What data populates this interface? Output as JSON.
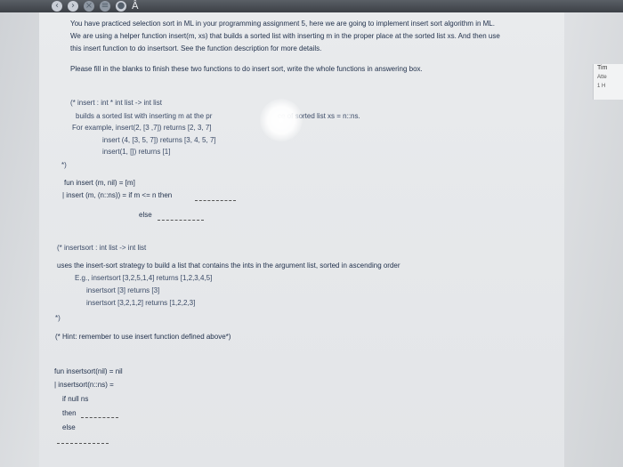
{
  "browser": {
    "icons": [
      "back-icon",
      "forward-icon",
      "close-tab-icon",
      "apps-icon",
      "profile-icon"
    ],
    "extra_glyph": "Â"
  },
  "side_panel": {
    "title": "Tim",
    "line2": "Atte",
    "line3": "1 H"
  },
  "assignment": {
    "intro_1": "You have practiced selection sort in ML in your programming assignment 5, here we are going to implement insert sort algorithm in ML.",
    "intro_2": "We are using a helper function insert(m, xs) that builds a sorted list with inserting m in the proper place at the sorted list xs. And then use",
    "intro_3": "this insert function to do insertsort. See the function description for more details.",
    "instruction": "Please fill in the blanks to finish these two functions to do insert sort, write the whole functions in answering box.",
    "insert_comment": [
      "(* insert : int * int list -> int list",
      "builds a sorted list with inserting m at the pr",
      "ce of sorted list xs = n::ns.",
      "For example,  insert(2, [3 ,7])  returns  [2, 3, 7]",
      "insert (4, [3, 5, 7])  returns  [3, 4, 5, 7]",
      "insert(1, [])  returns  [1]",
      "*)"
    ],
    "insert_code": [
      "fun insert (m, nil) = [m]",
      "| insert (m, (n::ns)) = if m <= n then",
      "else"
    ],
    "insertsort_comment": [
      "(* insertsort : int list -> int list",
      "uses the insert-sort strategy to build a list that contains the ints in the argument list, sorted in ascending order",
      "E.g., insertsort [3,2,5,1,4] returns [1,2,3,4,5]",
      "insertsort [3] returns [3]",
      "insertsort [3,2,1,2] returns [1,2,2,3]",
      "*)",
      "(* Hint: remember to use insert function defined above*)"
    ],
    "insertsort_code": [
      "fun insertsort(nil) = nil",
      "| insertsort(n::ns) =",
      "if null ns",
      "then",
      "else"
    ]
  }
}
